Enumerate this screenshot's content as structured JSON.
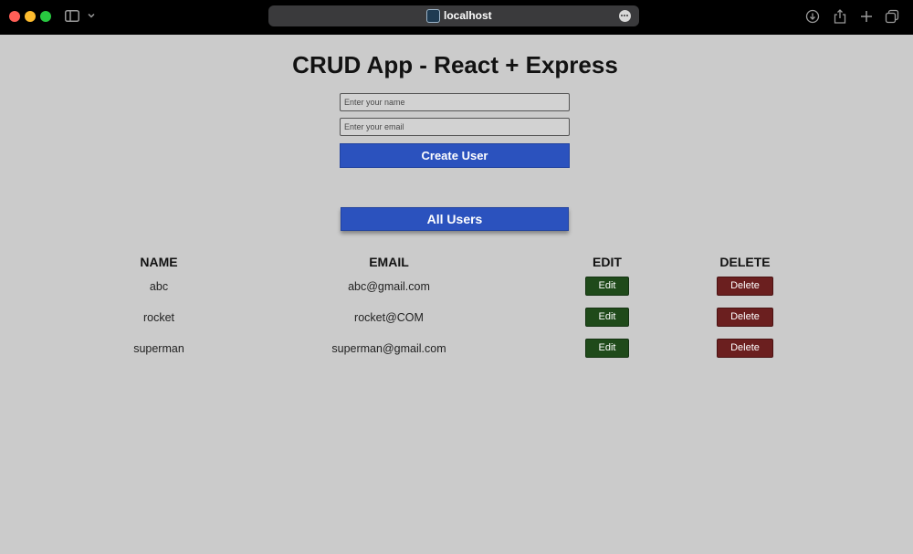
{
  "browser": {
    "url": "localhost",
    "colors": {
      "close": "#ff5f57",
      "minimize": "#febc2e",
      "maximize": "#28c840"
    }
  },
  "app": {
    "title": "CRUD App - React + Express",
    "name_placeholder": "Enter your name",
    "email_placeholder": "Enter your email",
    "create_label": "Create User",
    "all_users_label": "All Users",
    "accent": "#2b52be"
  },
  "table": {
    "headers": {
      "name": "NAME",
      "email": "EMAIL",
      "edit": "EDIT",
      "delete": "DELETE"
    },
    "edit_label": "Edit",
    "delete_label": "Delete",
    "edit_color": "#1f4a1a",
    "delete_color": "#6b1f1f",
    "rows": [
      {
        "name": "abc",
        "email": "abc@gmail.com"
      },
      {
        "name": "rocket",
        "email": "rocket@COM"
      },
      {
        "name": "superman",
        "email": "superman@gmail.com"
      }
    ]
  }
}
